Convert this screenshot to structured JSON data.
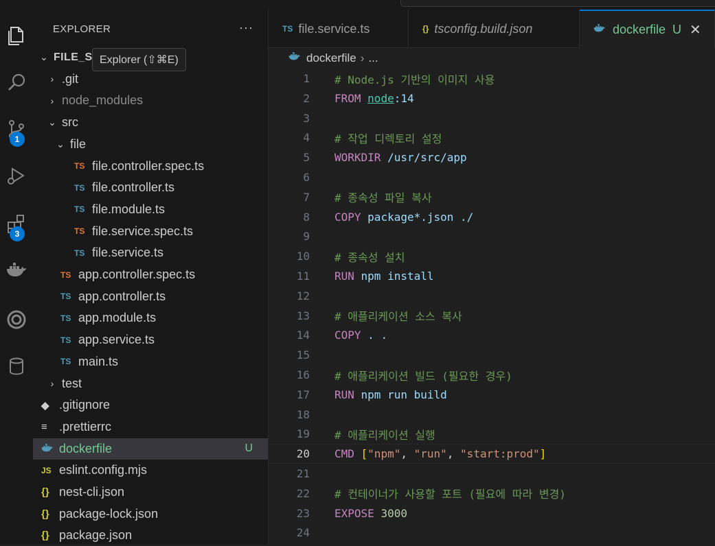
{
  "sidebar": {
    "title": "EXPLORER",
    "more": "···",
    "root": "FILE_S",
    "tooltip": "Explorer (⇧⌘E)",
    "tree": [
      {
        "label": ".git",
        "type": "folder",
        "expanded": false,
        "depth": 1,
        "dim": false
      },
      {
        "label": "node_modules",
        "type": "folder",
        "expanded": false,
        "depth": 1,
        "dim": true
      },
      {
        "label": "src",
        "type": "folder",
        "expanded": true,
        "depth": 1,
        "dim": false
      },
      {
        "label": "file",
        "type": "folder",
        "expanded": true,
        "depth": 2,
        "dim": false
      },
      {
        "label": "file.controller.spec.ts",
        "type": "tsspec",
        "depth": 3
      },
      {
        "label": "file.controller.ts",
        "type": "ts",
        "depth": 3
      },
      {
        "label": "file.module.ts",
        "type": "ts",
        "depth": 3
      },
      {
        "label": "file.service.spec.ts",
        "type": "tsspec",
        "depth": 3
      },
      {
        "label": "file.service.ts",
        "type": "ts",
        "depth": 3
      },
      {
        "label": "app.controller.spec.ts",
        "type": "tsspec",
        "depth": 2
      },
      {
        "label": "app.controller.ts",
        "type": "ts",
        "depth": 2
      },
      {
        "label": "app.module.ts",
        "type": "ts",
        "depth": 2
      },
      {
        "label": "app.service.ts",
        "type": "ts",
        "depth": 2
      },
      {
        "label": "main.ts",
        "type": "ts",
        "depth": 2
      },
      {
        "label": "test",
        "type": "folder",
        "expanded": false,
        "depth": 1,
        "dim": false
      },
      {
        "label": ".gitignore",
        "type": "git",
        "depth": 1
      },
      {
        "label": ".prettierrc",
        "type": "txt",
        "depth": 1
      },
      {
        "label": "dockerfile",
        "type": "docker",
        "depth": 1,
        "selected": true,
        "status": "U"
      },
      {
        "label": "eslint.config.mjs",
        "type": "js",
        "depth": 1
      },
      {
        "label": "nest-cli.json",
        "type": "json",
        "depth": 1
      },
      {
        "label": "package-lock.json",
        "type": "json",
        "depth": 1
      },
      {
        "label": "package.json",
        "type": "json",
        "depth": 1
      }
    ]
  },
  "activity": {
    "items": [
      {
        "name": "files-icon"
      },
      {
        "name": "search-icon"
      },
      {
        "name": "source-control-icon",
        "badge": "1"
      },
      {
        "name": "run-debug-icon"
      },
      {
        "name": "extensions-icon",
        "badge": "3"
      },
      {
        "name": "docker-icon"
      },
      {
        "name": "remote-icon"
      },
      {
        "name": "database-icon"
      }
    ]
  },
  "tabs": [
    {
      "icon": "TS",
      "label": "file.service.ts",
      "active": false
    },
    {
      "icon": "{}",
      "label": "tsconfig.build.json",
      "active": false,
      "italic": true
    },
    {
      "icon": "docker",
      "label": "dockerfile",
      "active": true,
      "status": "U",
      "close": "✕"
    }
  ],
  "breadcrumb": {
    "file": "dockerfile",
    "rest": "..."
  },
  "editor": {
    "current_line": 20,
    "lines": [
      {
        "n": "1",
        "tokens": [
          {
            "c": "t-comment",
            "t": "# Node.js 기반의 이미지 사용"
          }
        ]
      },
      {
        "n": "2",
        "tokens": [
          {
            "c": "t-kw",
            "t": "FROM "
          },
          {
            "c": "t-img",
            "t": "node"
          },
          {
            "c": "t-arg",
            "t": ":14"
          }
        ]
      },
      {
        "n": "3",
        "tokens": []
      },
      {
        "n": "4",
        "tokens": [
          {
            "c": "t-comment",
            "t": "# 작업 디렉토리 설정"
          }
        ]
      },
      {
        "n": "5",
        "tokens": [
          {
            "c": "t-kw",
            "t": "WORKDIR "
          },
          {
            "c": "t-arg",
            "t": "/usr/src/app"
          }
        ]
      },
      {
        "n": "6",
        "tokens": []
      },
      {
        "n": "7",
        "tokens": [
          {
            "c": "t-comment",
            "t": "# 종속성 파일 복사"
          }
        ]
      },
      {
        "n": "8",
        "tokens": [
          {
            "c": "t-kw",
            "t": "COPY "
          },
          {
            "c": "t-arg",
            "t": "package*.json ./"
          }
        ]
      },
      {
        "n": "9",
        "tokens": []
      },
      {
        "n": "10",
        "tokens": [
          {
            "c": "t-comment",
            "t": "# 종속성 설치"
          }
        ]
      },
      {
        "n": "11",
        "tokens": [
          {
            "c": "t-kw",
            "t": "RUN "
          },
          {
            "c": "t-arg",
            "t": "npm install"
          }
        ]
      },
      {
        "n": "12",
        "tokens": []
      },
      {
        "n": "13",
        "tokens": [
          {
            "c": "t-comment",
            "t": "# 애플리케이션 소스 복사"
          }
        ]
      },
      {
        "n": "14",
        "tokens": [
          {
            "c": "t-kw",
            "t": "COPY "
          },
          {
            "c": "t-arg",
            "t": ". ."
          }
        ]
      },
      {
        "n": "15",
        "tokens": []
      },
      {
        "n": "16",
        "tokens": [
          {
            "c": "t-comment",
            "t": "# 애플리케이션 빌드 (필요한 경우)"
          }
        ]
      },
      {
        "n": "17",
        "tokens": [
          {
            "c": "t-kw",
            "t": "RUN "
          },
          {
            "c": "t-arg",
            "t": "npm run build"
          }
        ]
      },
      {
        "n": "18",
        "tokens": []
      },
      {
        "n": "19",
        "tokens": [
          {
            "c": "t-comment",
            "t": "# 애플리케이션 실행"
          }
        ]
      },
      {
        "n": "20",
        "tokens": [
          {
            "c": "t-kw",
            "t": "CMD "
          },
          {
            "c": "t-brk",
            "t": "["
          },
          {
            "c": "t-str",
            "t": "\"npm\""
          },
          {
            "c": "t-punc",
            "t": ", "
          },
          {
            "c": "t-str",
            "t": "\"run\""
          },
          {
            "c": "t-punc",
            "t": ", "
          },
          {
            "c": "t-str",
            "t": "\"start:prod\""
          },
          {
            "c": "t-brk",
            "t": "]"
          }
        ]
      },
      {
        "n": "21",
        "tokens": []
      },
      {
        "n": "22",
        "tokens": [
          {
            "c": "t-comment",
            "t": "# 컨테이너가 사용할 포트 (필요에 따라 변경)"
          }
        ]
      },
      {
        "n": "23",
        "tokens": [
          {
            "c": "t-kw",
            "t": "EXPOSE "
          },
          {
            "c": "t-num",
            "t": "3000"
          }
        ]
      },
      {
        "n": "24",
        "tokens": []
      }
    ]
  }
}
